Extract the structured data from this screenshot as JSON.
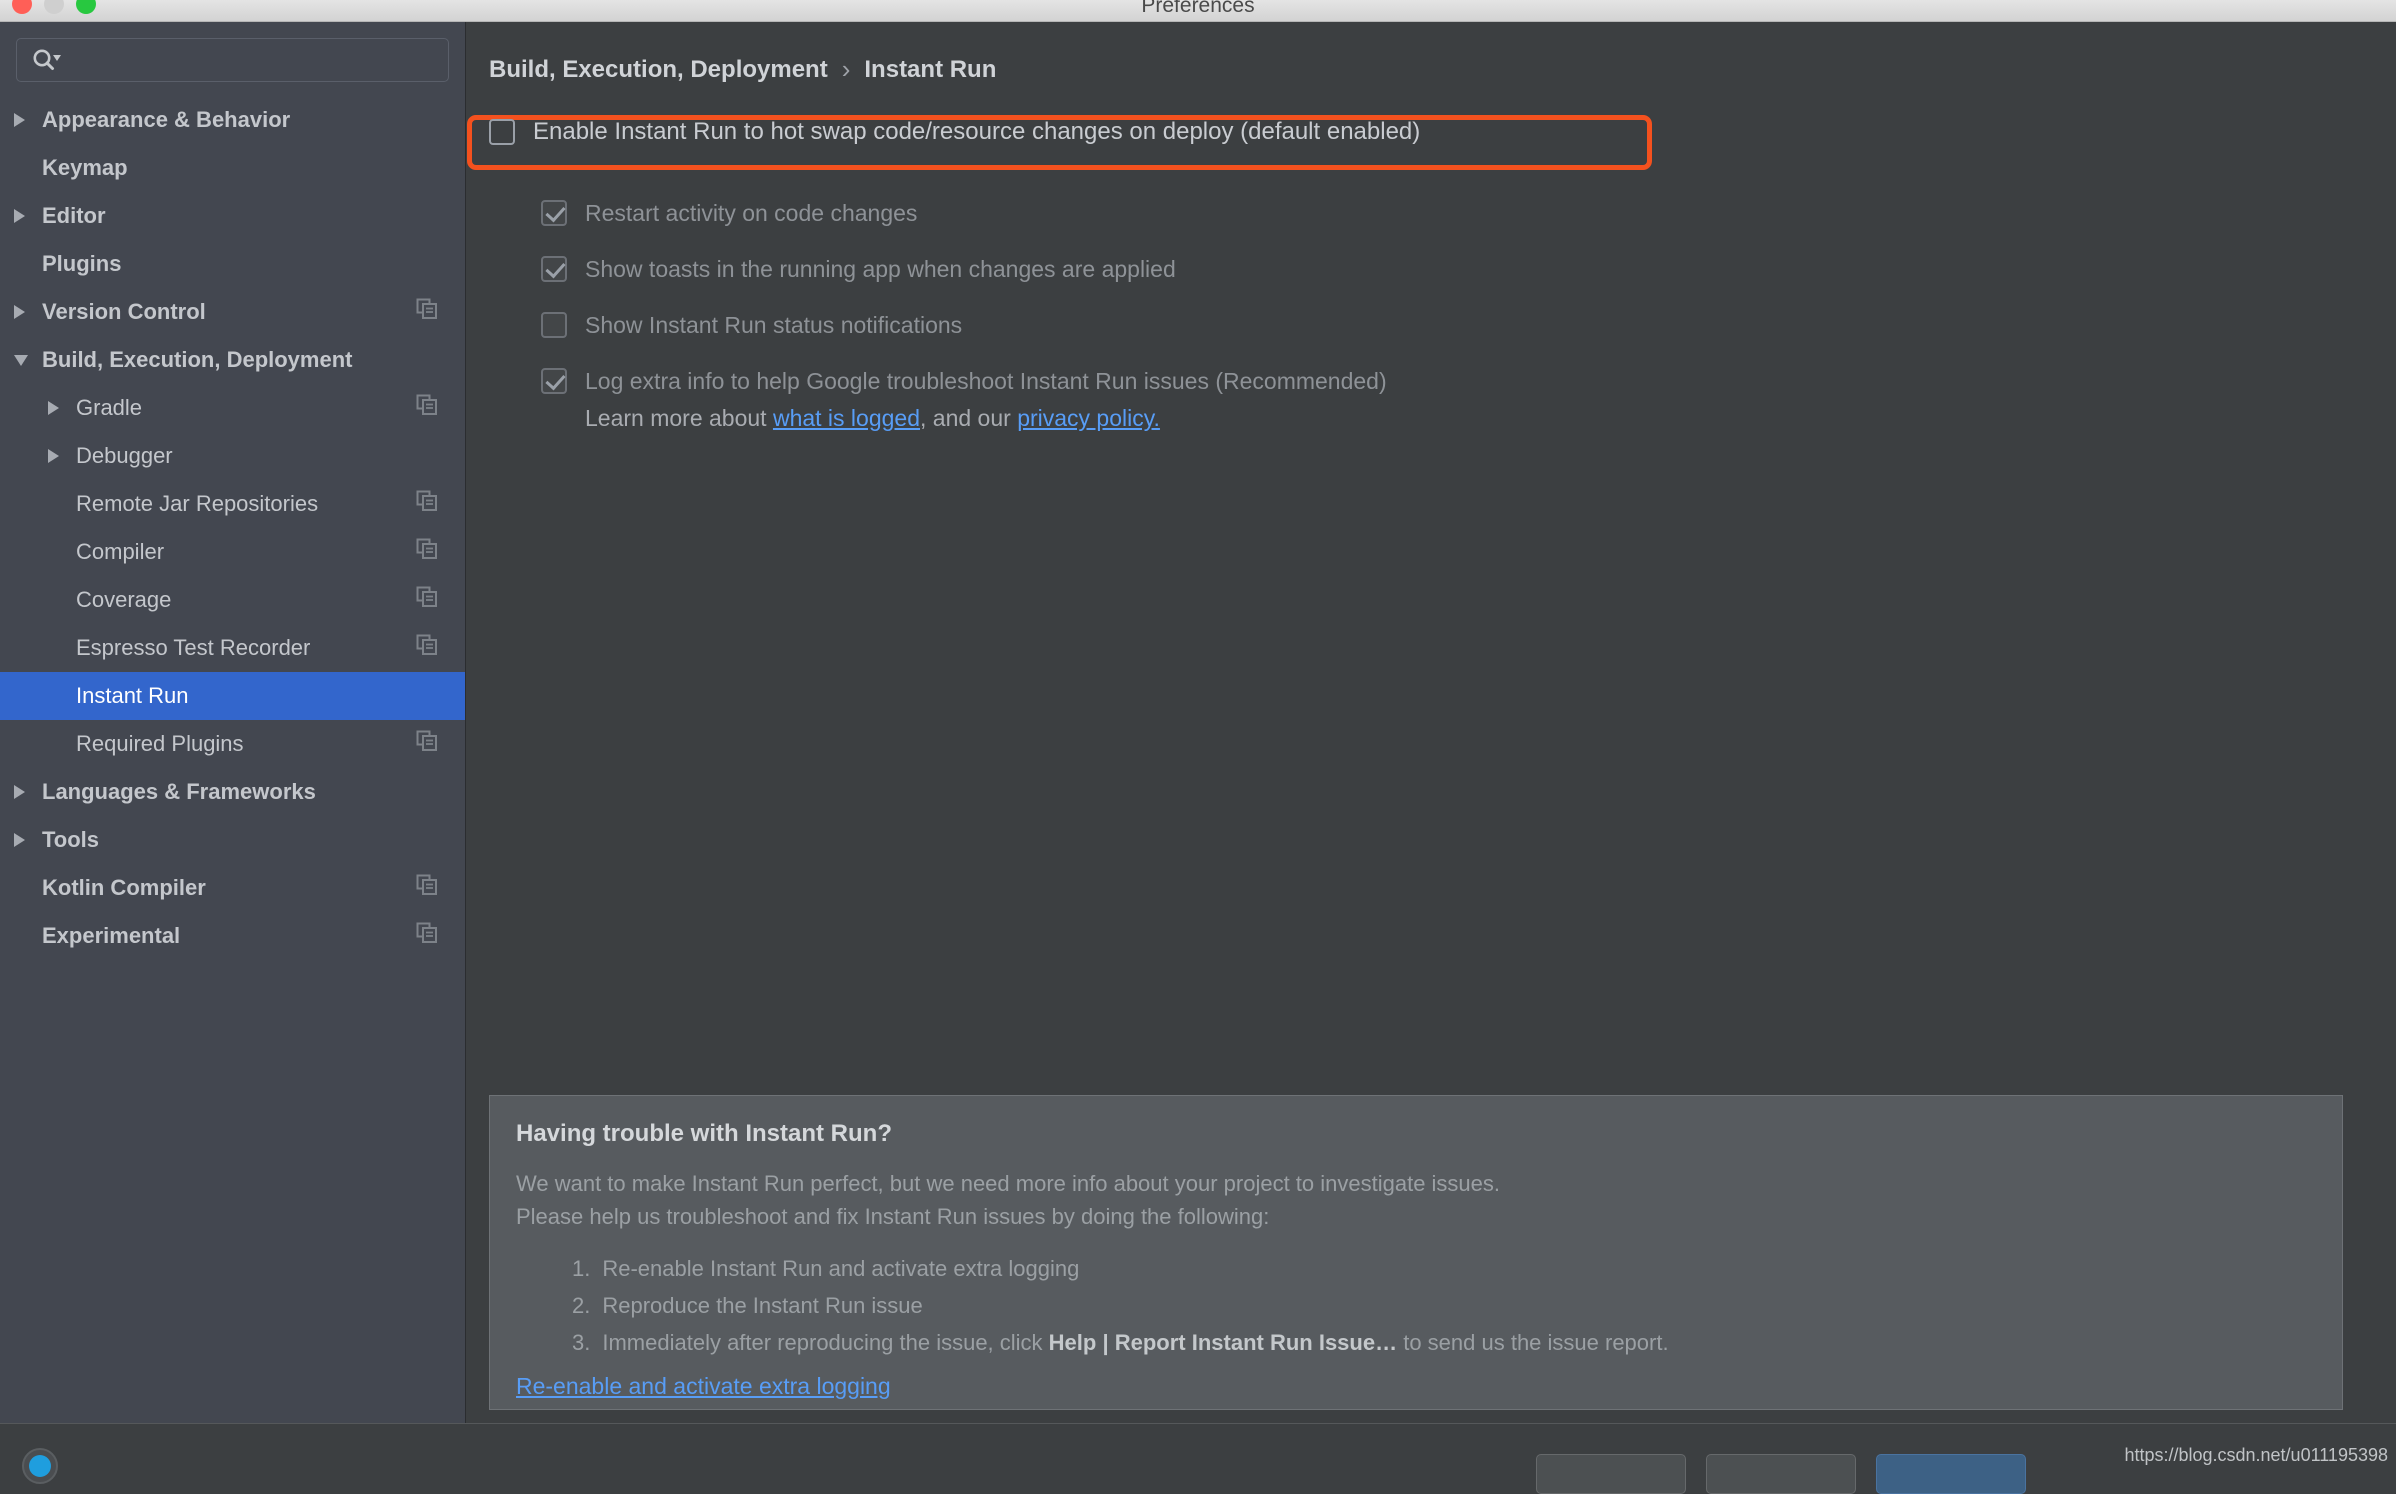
{
  "window": {
    "title": "Preferences",
    "traffic_lights": [
      "close",
      "minimize",
      "zoom"
    ]
  },
  "sidebar": {
    "search": {
      "value": "",
      "placeholder": ""
    },
    "items": [
      {
        "label": "Appearance & Behavior",
        "indent": 0,
        "arrow": "right",
        "bold": true,
        "copy": false,
        "selected": false
      },
      {
        "label": "Keymap",
        "indent": 0,
        "arrow": "none",
        "bold": true,
        "copy": false,
        "selected": false
      },
      {
        "label": "Editor",
        "indent": 0,
        "arrow": "right",
        "bold": true,
        "copy": false,
        "selected": false
      },
      {
        "label": "Plugins",
        "indent": 0,
        "arrow": "none",
        "bold": true,
        "copy": false,
        "selected": false
      },
      {
        "label": "Version Control",
        "indent": 0,
        "arrow": "right",
        "bold": true,
        "copy": true,
        "selected": false
      },
      {
        "label": "Build, Execution, Deployment",
        "indent": 0,
        "arrow": "down",
        "bold": true,
        "copy": false,
        "selected": false
      },
      {
        "label": "Gradle",
        "indent": 1,
        "arrow": "right",
        "bold": false,
        "copy": true,
        "selected": false
      },
      {
        "label": "Debugger",
        "indent": 1,
        "arrow": "right",
        "bold": false,
        "copy": false,
        "selected": false
      },
      {
        "label": "Remote Jar Repositories",
        "indent": 1,
        "arrow": "none",
        "bold": false,
        "copy": true,
        "selected": false
      },
      {
        "label": "Compiler",
        "indent": 1,
        "arrow": "none",
        "bold": false,
        "copy": true,
        "selected": false
      },
      {
        "label": "Coverage",
        "indent": 1,
        "arrow": "none",
        "bold": false,
        "copy": true,
        "selected": false
      },
      {
        "label": "Espresso Test Recorder",
        "indent": 1,
        "arrow": "none",
        "bold": false,
        "copy": true,
        "selected": false
      },
      {
        "label": "Instant Run",
        "indent": 1,
        "arrow": "none",
        "bold": false,
        "copy": false,
        "selected": true
      },
      {
        "label": "Required Plugins",
        "indent": 1,
        "arrow": "none",
        "bold": false,
        "copy": true,
        "selected": false
      },
      {
        "label": "Languages & Frameworks",
        "indent": 0,
        "arrow": "right",
        "bold": true,
        "copy": false,
        "selected": false
      },
      {
        "label": "Tools",
        "indent": 0,
        "arrow": "right",
        "bold": true,
        "copy": false,
        "selected": false
      },
      {
        "label": "Kotlin Compiler",
        "indent": 0,
        "arrow": "none",
        "bold": true,
        "copy": true,
        "selected": false
      },
      {
        "label": "Experimental",
        "indent": 0,
        "arrow": "none",
        "bold": true,
        "copy": true,
        "selected": false
      }
    ]
  },
  "breadcrumb": {
    "parent": "Build, Execution, Deployment",
    "separator": "›",
    "current": "Instant Run"
  },
  "main": {
    "enable_checkbox": {
      "label": "Enable Instant Run to hot swap code/resource changes on deploy (default enabled)",
      "checked": false,
      "highlighted": true,
      "highlight_color": "#f4511e"
    },
    "sub_checkboxes": [
      {
        "label": "Restart activity on code changes",
        "checked": true,
        "disabled": true
      },
      {
        "label": "Show toasts in the running app when changes are applied",
        "checked": true,
        "disabled": true
      },
      {
        "label": "Show Instant Run status notifications",
        "checked": false,
        "disabled": true
      },
      {
        "label": "Log extra info to help Google troubleshoot Instant Run issues (Recommended)",
        "checked": true,
        "disabled": true
      }
    ],
    "learn_more": {
      "prefix": "Learn more about ",
      "link1": "what is logged",
      "middle": ", and our ",
      "link2": "privacy policy."
    }
  },
  "trouble_panel": {
    "heading": "Having trouble with Instant Run?",
    "line1": "We want to make Instant Run perfect, but we need more info about your project to investigate issues.",
    "line2": "Please help us troubleshoot and fix Instant Run issues by doing the following:",
    "steps": [
      {
        "num": "1.",
        "pre": "Re-enable Instant Run and activate extra logging",
        "bold": "",
        "post": ""
      },
      {
        "num": "2.",
        "pre": "Reproduce the Instant Run issue",
        "bold": "",
        "post": ""
      },
      {
        "num": "3.",
        "pre": "Immediately after reproducing the issue, click ",
        "bold": "Help | Report Instant Run Issue…",
        "post": " to send us the issue report."
      }
    ],
    "link": "Re-enable and activate extra logging"
  },
  "footer": {
    "help_icon": "help-circle-icon",
    "buttons": [
      "",
      "",
      ""
    ]
  },
  "watermark": "https://blog.csdn.net/u011195398",
  "colors": {
    "sidebar_bg": "#434750",
    "content_bg": "#3c3f41",
    "panel_bg": "#575b5f",
    "selection": "#3366cc",
    "link": "#589df6",
    "highlight": "#f4511e"
  }
}
